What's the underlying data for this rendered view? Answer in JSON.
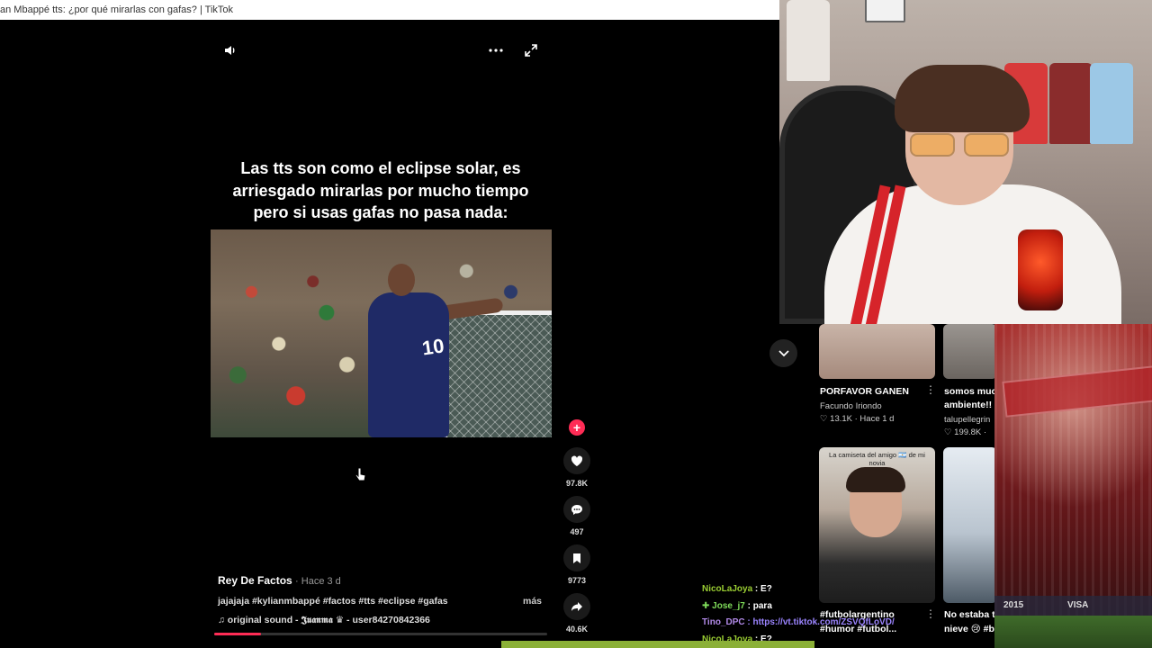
{
  "window": {
    "title": "an Mbappé tts: ¿por qué mirarlas con gafas? | TikTok"
  },
  "video": {
    "caption_lines": [
      "Las tts son como el eclipse solar, es",
      "arriesgado mirarlas por mucho tiempo",
      "pero si usas gafas no pasa nada:"
    ],
    "jersey_number": "10",
    "progress_fraction": 0.14
  },
  "actions": {
    "likes": "97.8K",
    "comments": "497",
    "saves": "9773",
    "shares": "40.6K"
  },
  "post": {
    "author": "Rey De Factos",
    "time": "· Hace 3 d",
    "description": "jajajaja #kylianmbappé #factos #tts #eclipse #gafas",
    "more_label": "más",
    "sound": "original sound - 𝕵𝖚𝖆𝖓𝖒𝖆 ♛ - user84270842366"
  },
  "recommendations": [
    {
      "title": "PORFAVOR GANEN",
      "user": "Facundo Iriondo",
      "stats": "♡ 13.1K · Hace 1 d"
    },
    {
      "title": "somos muc",
      "subtitle": "ambiente!!",
      "user": "talupellegrin",
      "stats": "♡ 199.8K ·"
    },
    {
      "title": "#futbolargentino",
      "subtitle": "#humor #futbol...",
      "overlay": "La camiseta del amigo 🇦🇷 de mi novia"
    },
    {
      "title": "No estaba t",
      "subtitle": "nieve 😢 #b"
    }
  ],
  "chat": [
    {
      "user": "NicoLaJoya",
      "msg": " : E?",
      "style": "u1"
    },
    {
      "user": "Jose_j7",
      "msg": " : para",
      "style": "u2",
      "badge": "✚"
    },
    {
      "user": "Tino_DPC",
      "msg": " : https://vt.tiktok.com/ZSVQfLoVD/",
      "style": "u3"
    },
    {
      "user": "NicoLaJoya",
      "msg": " : E?",
      "style": "u1"
    }
  ],
  "stadium": {
    "ad_text": "2015",
    "brand_text": "VISA"
  },
  "colors": {
    "accent": "#fe2c55",
    "chat_green": "#9acd32",
    "chat_purple": "#b28ae8"
  }
}
